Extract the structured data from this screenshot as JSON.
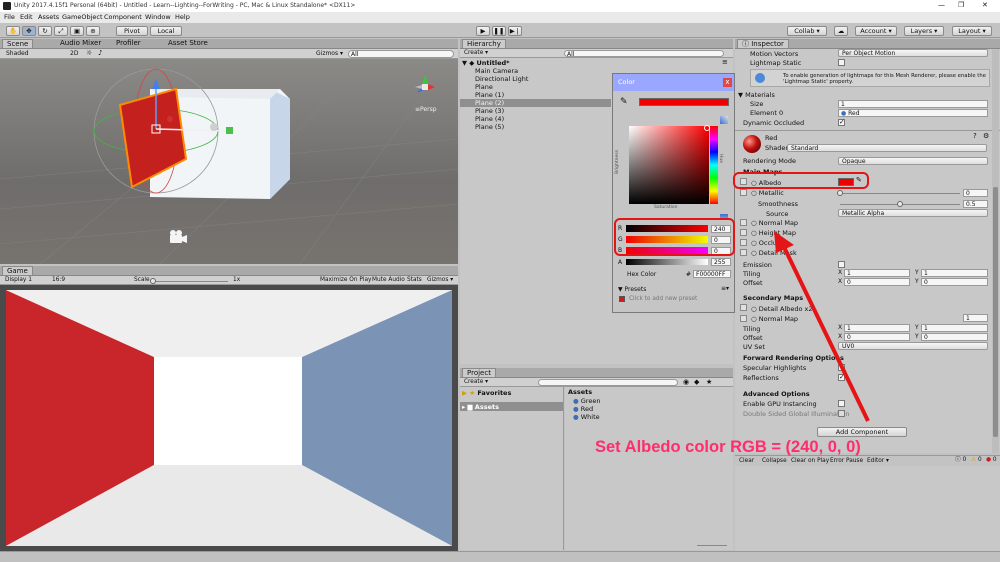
{
  "window": {
    "title": "Unity 2017.4.15f1 Personal (64bit) - Untitled - Learn--Lighting--ForWriting - PC, Mac & Linux Standalone* <DX11>",
    "min": "—",
    "max": "❐",
    "close": "✕"
  },
  "menu": [
    "File",
    "Edit",
    "Assets",
    "GameObject",
    "Component",
    "Window",
    "Help"
  ],
  "toolbar": {
    "pivot": "Pivot",
    "local": "Local",
    "collab": "Collab ▾",
    "account": "Account ▾",
    "layers": "Layers ▾",
    "layout": "Layout ▾"
  },
  "scene": {
    "tabs": [
      "Scene",
      "Audio Mixer",
      "Profiler",
      "Asset Store"
    ],
    "shaded": "Shaded",
    "mode2d": "2D",
    "gizmos": "Gizmos ▾",
    "search": "All",
    "persp": "≡Persp"
  },
  "game": {
    "tab": "Game",
    "display": "Display 1",
    "aspect": "16:9",
    "scale_label": "Scale",
    "scale_value": "1x",
    "maximize": "Maximize On Play",
    "mute": "Mute Audio",
    "stats": "Stats",
    "gizmos": "Gizmos ▾"
  },
  "hierarchy": {
    "tab": "Hierarchy",
    "create": "Create ▾",
    "search": "All",
    "scene": "Untitled*",
    "items": [
      "Main Camera",
      "Directional Light",
      "Plane",
      "Plane (1)",
      "Plane (2)",
      "Plane (3)",
      "Plane (4)",
      "Plane (5)"
    ],
    "selected_index": 4
  },
  "color_picker": {
    "title": "Color",
    "close": "x",
    "hue": "Hue",
    "brightness": "Brightness",
    "saturation": "Saturation",
    "channels": [
      {
        "label": "R",
        "value": "240"
      },
      {
        "label": "G",
        "value": "0"
      },
      {
        "label": "B",
        "value": "0"
      },
      {
        "label": "A",
        "value": "255"
      }
    ],
    "hex_label": "Hex Color",
    "hex_hash": "#",
    "hex_value": "F00000FF",
    "presets": "▼ Presets",
    "add_preset": "Click to add new preset",
    "swatch": "#f00000"
  },
  "project": {
    "tab": "Project",
    "create": "Create ▾",
    "favorites": "Favorites",
    "assets": "Assets",
    "list_header": "Assets",
    "files": [
      "Green",
      "Red",
      "White"
    ]
  },
  "inspector": {
    "tab": "Inspector",
    "motion_vectors": {
      "label": "Motion Vectors",
      "value": "Per Object Motion"
    },
    "lightmap_static": "Lightmap Static",
    "info": "To enable generation of lightmaps for this Mesh Renderer, please enable the 'Lightmap Static' property.",
    "materials": "▼ Materials",
    "size": {
      "label": "Size",
      "value": "1"
    },
    "element0": {
      "label": "Element 0",
      "value": "Red"
    },
    "dynamic_occluded": "Dynamic Occluded",
    "material_name": "Red",
    "shader": {
      "label": "Shader",
      "value": "Standard"
    },
    "rendering_mode": {
      "label": "Rendering Mode",
      "value": "Opaque"
    },
    "main_maps": "Main Maps",
    "albedo": "Albedo",
    "metallic": {
      "label": "Metallic",
      "value": "0"
    },
    "smoothness": {
      "label": "Smoothness",
      "value": "0.5"
    },
    "source": {
      "label": "Source",
      "value": "Metallic Alpha"
    },
    "normal_map": "Normal Map",
    "height_map": "Height Map",
    "occlusion": "Occlusion",
    "detail_mask": "Detail Mask",
    "emission": "Emission",
    "tiling": {
      "label": "Tiling",
      "x": "1",
      "y": "1"
    },
    "offset": {
      "label": "Offset",
      "x": "0",
      "y": "0"
    },
    "secondary_maps": "Secondary Maps",
    "detail_albedo": "Detail Albedo x2",
    "normal_map2": {
      "label": "Normal Map",
      "value": "1"
    },
    "tiling2": {
      "label": "Tiling",
      "x": "1",
      "y": "1"
    },
    "offset2": {
      "label": "Offset",
      "x": "0",
      "y": "0"
    },
    "uv_set": {
      "label": "UV Set",
      "value": "UV0"
    },
    "forward": "Forward Rendering Options",
    "specular": "Specular Highlights",
    "reflections": "Reflections",
    "advanced": "Advanced Options",
    "gpu_instancing": "Enable GPU Instancing",
    "double_sided": "Double Sided Global Illumination",
    "add_component": "Add Component",
    "x_label": "X",
    "y_label": "Y"
  },
  "console": {
    "clear": "Clear",
    "collapse": "Collapse",
    "clear_on_play": "Clear on Play",
    "error_pause": "Error Pause",
    "editor": "Editor ▾",
    "c1": "0",
    "c2": "0",
    "c3": "0"
  },
  "annotation": "Set Albedo color RGB = (240, 0, 0)",
  "colors": {
    "accent_red": "#e51515",
    "albedo": "#f00000",
    "annotation_text": "#ff2d6e",
    "selection": "#3d6fb6"
  }
}
